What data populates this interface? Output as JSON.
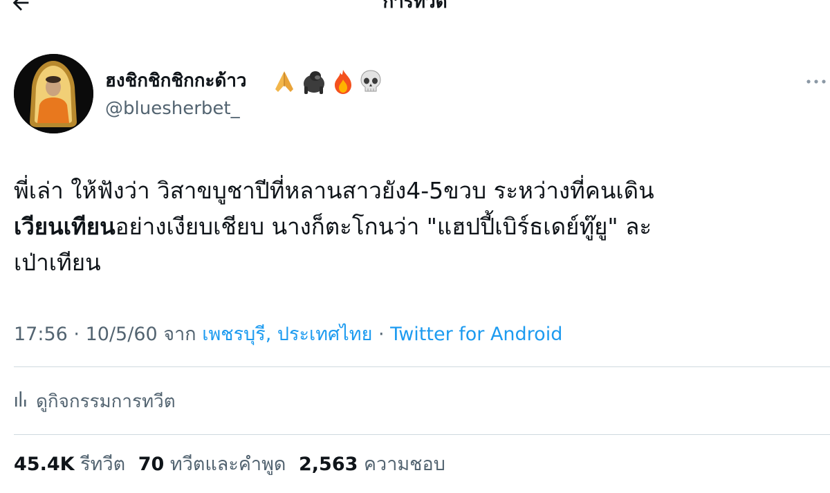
{
  "header": {
    "title": "การทวีต",
    "back_icon": "arrow-left-icon"
  },
  "tweet": {
    "author": {
      "display_name": "ฮงชิกชิกชิกกะด้าว",
      "handle": "@bluesherbet_",
      "name_emojis": [
        "folded-hands-icon",
        "gorilla-icon",
        "fire-icon",
        "skull-icon"
      ]
    },
    "text": {
      "line1": "พี่เล่า ให้ฟังว่า วิสาขบูชาปีที่หลานสาวยัง4-5ขวบ ระหว่างที่คนเดิน",
      "line2_bold": "เวียนเทียน",
      "line2_rest": "อย่างเงียบเชียบ นางก็ตะโกนว่า \"แฮปปี้เบิร์ธเดย์ทู๊ยู\" ละ",
      "line3": "เป่าเทียน"
    },
    "meta": {
      "time": "17:56",
      "date": "10/5/60",
      "from_label": "จาก",
      "location": "เพชรบุรี, ประเทศไทย",
      "source": "Twitter for Android",
      "separator": "·"
    },
    "activity_label": "ดูกิจกรรมการทวีต",
    "stats": {
      "retweets_count": "45.4K",
      "retweets_label": "รีทวีต",
      "quotes_count": "70",
      "quotes_label": "ทวีตและคำพูด",
      "likes_count": "2,563",
      "likes_label": "ความชอบ"
    }
  },
  "colors": {
    "text_primary": "#0f1419",
    "text_secondary": "#536471",
    "link": "#1d9bf0",
    "divider": "#cfd9de"
  }
}
